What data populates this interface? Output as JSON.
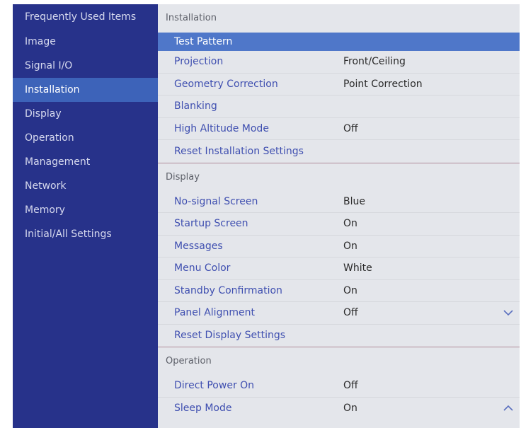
{
  "sidebar": {
    "items": [
      {
        "label": "Frequently Used Items"
      },
      {
        "label": "Image"
      },
      {
        "label": "Signal I/O"
      },
      {
        "label": "Installation"
      },
      {
        "label": "Display"
      },
      {
        "label": "Operation"
      },
      {
        "label": "Management"
      },
      {
        "label": "Network"
      },
      {
        "label": "Memory"
      },
      {
        "label": "Initial/All Settings"
      }
    ],
    "active_index": 3
  },
  "installation": {
    "header": "Installation",
    "rows": [
      {
        "label": "Test Pattern",
        "value": ""
      },
      {
        "label": "Projection",
        "value": "Front/Ceiling"
      },
      {
        "label": "Geometry Correction",
        "value": "Point Correction"
      },
      {
        "label": "Blanking",
        "value": ""
      },
      {
        "label": "High Altitude Mode",
        "value": "Off"
      },
      {
        "label": "Reset Installation Settings",
        "value": ""
      }
    ]
  },
  "display": {
    "header": "Display",
    "rows": [
      {
        "label": "No-signal Screen",
        "value": "Blue"
      },
      {
        "label": "Startup Screen",
        "value": "On"
      },
      {
        "label": "Messages",
        "value": "On"
      },
      {
        "label": "Menu Color",
        "value": "White"
      },
      {
        "label": "Standby Confirmation",
        "value": "On"
      },
      {
        "label": "Panel Alignment",
        "value": "Off"
      },
      {
        "label": "Reset Display Settings",
        "value": ""
      }
    ]
  },
  "operation": {
    "header": "Operation",
    "rows": [
      {
        "label": "Direct Power On",
        "value": "Off"
      },
      {
        "label": "Sleep Mode",
        "value": "On"
      }
    ]
  },
  "icons": {
    "scroll_down": "chevron-down-icon",
    "scroll_up": "chevron-up-icon"
  },
  "colors": {
    "sidebar_bg": "#27328a",
    "sidebar_active": "#3d63b9",
    "content_bg": "#e4e6eb",
    "selected_row": "#4f77c9",
    "item_label": "#3f4fb0"
  }
}
